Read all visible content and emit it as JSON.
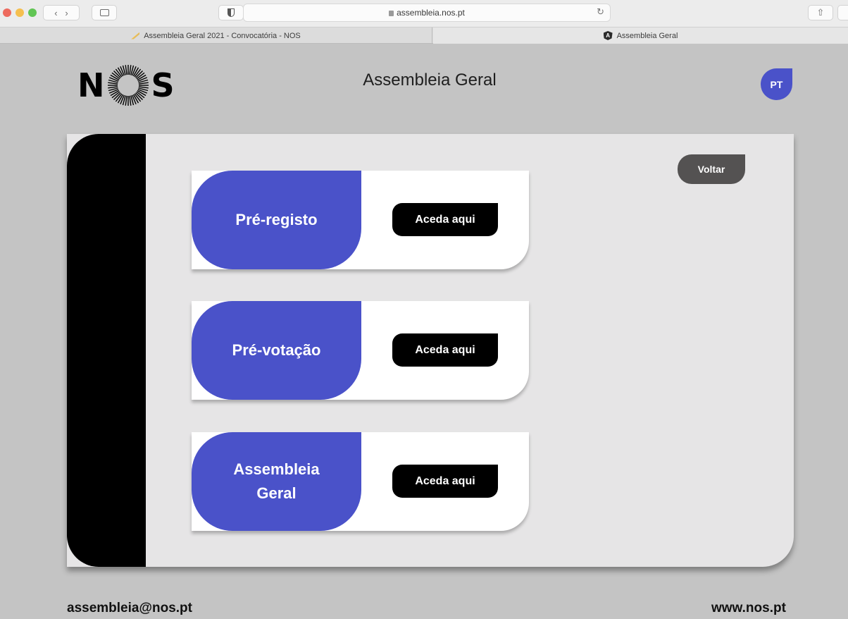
{
  "browser": {
    "url": "assembleia.nos.pt",
    "tabs": [
      {
        "label": "Assembleia Geral 2021 - Convocatória - NOS"
      },
      {
        "label": "Assembleia Geral"
      }
    ]
  },
  "header": {
    "logo_text_left": "N",
    "logo_text_right": "S",
    "title": "Assembleia Geral",
    "language": "PT"
  },
  "main": {
    "back_label": "Voltar",
    "cards": [
      {
        "title": "Pré-registo",
        "button": "Aceda aqui"
      },
      {
        "title": "Pré-votação",
        "button": "Aceda aqui"
      },
      {
        "title": "Assembleia Geral",
        "button": "Aceda aqui"
      }
    ]
  },
  "footer": {
    "email": "assembleia@nos.pt",
    "website": "www.nos.pt"
  },
  "colors": {
    "brand_blue": "#4a52c9",
    "panel_bg": "#e6e5e6",
    "page_bg": "#c4c4c4",
    "dark_button": "#545252"
  }
}
